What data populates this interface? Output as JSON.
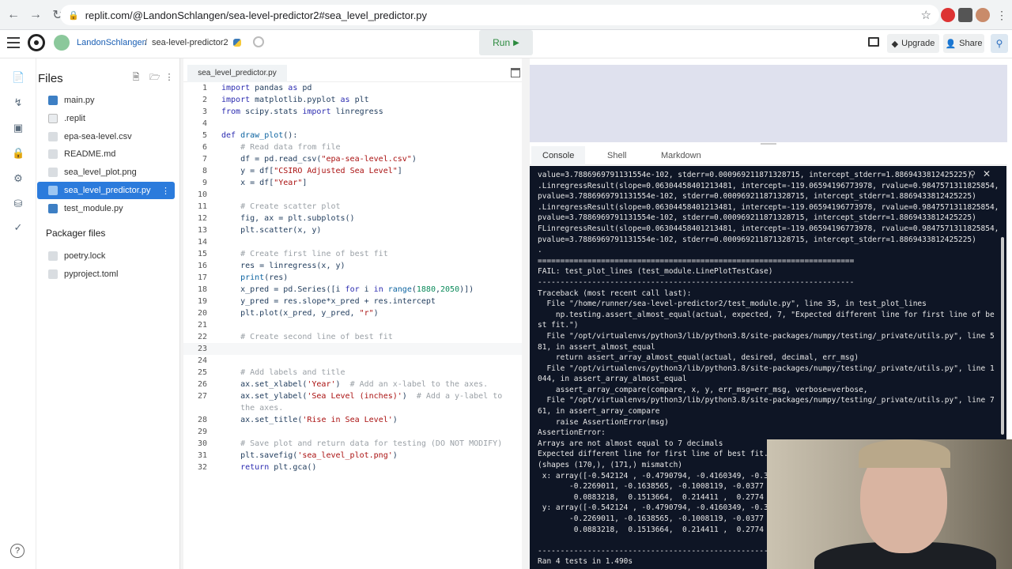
{
  "browser": {
    "url": "replit.com/@LandonSchlangen/sea-level-predictor2#sea_level_predictor.py"
  },
  "header": {
    "username": "LandonSchlangen",
    "separator": "/",
    "repl_name": "sea-level-predictor2",
    "run_label": "Run",
    "upgrade_label": "Upgrade",
    "share_label": "Share"
  },
  "files": {
    "title": "Files",
    "items": [
      {
        "name": "main.py"
      },
      {
        "name": ".replit"
      },
      {
        "name": "epa-sea-level.csv"
      },
      {
        "name": "README.md"
      },
      {
        "name": "sea_level_plot.png"
      },
      {
        "name": "sea_level_predictor.py"
      },
      {
        "name": "test_module.py"
      }
    ],
    "packager_title": "Packager files",
    "packager_items": [
      {
        "name": "poetry.lock"
      },
      {
        "name": "pyproject.toml"
      }
    ]
  },
  "editor": {
    "tab_label": "sea_level_predictor.py",
    "line_numbers": [
      "1",
      "2",
      "3",
      "4",
      "5",
      "6",
      "7",
      "8",
      "9",
      "10",
      "11",
      "12",
      "13",
      "14",
      "15",
      "16",
      "17",
      "18",
      "19",
      "20",
      "21",
      "22",
      "23",
      "24",
      "25",
      "26",
      "27",
      "",
      "28",
      "29",
      "30",
      "31",
      "32"
    ]
  },
  "console_tabs": {
    "console": "Console",
    "shell": "Shell",
    "markdown": "Markdown"
  },
  "console": {
    "lines": [
      "value=3.7886969791131554e-102, stderr=0.000969211871328715, intercept_stderr=1.8869433812425225)",
      ".LinregressResult(slope=0.06304458401213481, intercept=-119.06594196773978, rvalue=0.9847571311825854,",
      "pvalue=3.7886969791131554e-102, stderr=0.000969211871328715, intercept_stderr=1.8869433812425225)",
      ".LinregressResult(slope=0.06304458401213481, intercept=-119.06594196773978, rvalue=0.9847571311825854,",
      "pvalue=3.7886969791131554e-102, stderr=0.000969211871328715, intercept_stderr=1.8869433812425225)",
      "FLinregressResult(slope=0.06304458401213481, intercept=-119.06594196773978, rvalue=0.9847571311825854,",
      "pvalue=3.7886969791131554e-102, stderr=0.000969211871328715, intercept_stderr=1.8869433812425225)",
      ".",
      "======================================================================",
      "FAIL: test_plot_lines (test_module.LinePlotTestCase)",
      "----------------------------------------------------------------------",
      "Traceback (most recent call last):",
      "  File \"/home/runner/sea-level-predictor2/test_module.py\", line 35, in test_plot_lines",
      "    np.testing.assert_almost_equal(actual, expected, 7, \"Expected different line for first line of be",
      "st fit.\")",
      "  File \"/opt/virtualenvs/python3/lib/python3.8/site-packages/numpy/testing/_private/utils.py\", line 5",
      "81, in assert_almost_equal",
      "    return assert_array_almost_equal(actual, desired, decimal, err_msg)",
      "  File \"/opt/virtualenvs/python3/lib/python3.8/site-packages/numpy/testing/_private/utils.py\", line 1",
      "044, in assert_array_almost_equal",
      "    assert_array_compare(compare, x, y, err_msg=err_msg, verbose=verbose,",
      "  File \"/opt/virtualenvs/python3/lib/python3.8/site-packages/numpy/testing/_private/utils.py\", line 7",
      "61, in assert_array_compare",
      "    raise AssertionError(msg)",
      "AssertionError:",
      "Arrays are not almost equal to 7 decimals",
      "Expected different line for first line of best fit.",
      "(shapes (170,), (171,) mismatch)",
      " x: array([-0.542124 , -0.4790794, -0.4160349, -0.3",
      "       -0.2269011, -0.1638565, -0.1008119, -0.0377",
      "        0.0883218,  0.1513664,  0.214411 ,  0.2774",
      " y: array([-0.542124 , -0.4790794, -0.4160349, -0.3",
      "       -0.2269011, -0.1638565, -0.1008119, -0.0377",
      "        0.0883218,  0.1513664,  0.214411 ,  0.2774",
      "",
      "----------------------------------------------------------------------",
      "Ran 4 tests in 1.490s"
    ]
  }
}
